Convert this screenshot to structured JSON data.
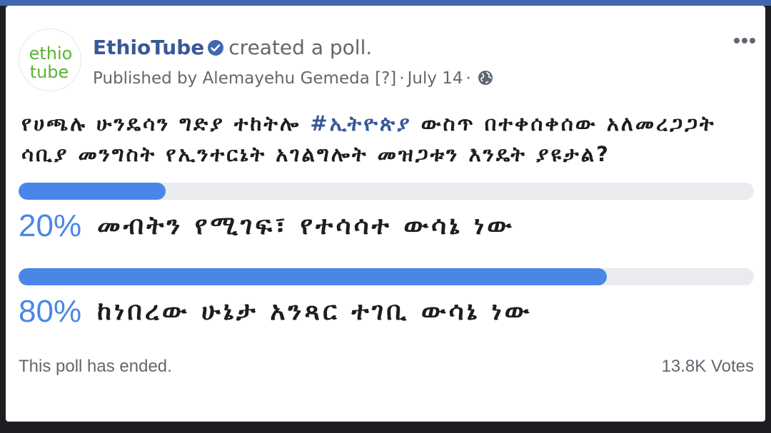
{
  "post": {
    "page_name": "EthioTube",
    "action": "created a poll.",
    "published_by": "Published by Alemayehu Gemeda",
    "help_marker": "[?]",
    "date": "July 14",
    "logo_line1": "ethio",
    "logo_line2": "tube"
  },
  "poll": {
    "question_part1": "የሀጫሉ ሁንዴሳን ግድያ ተከትሎ ",
    "hashtag": "#ኢትዮጵያ",
    "question_part2": " ውስጥ በተቀሰቀሰው አለመረጋጋት ሳቢያ መንግስት የኢንተርኔት አገልግሎት መዝጋቱን እንዴት ያዩታል?",
    "options": [
      {
        "percent_label": "20%",
        "fraction": 0.2,
        "text": "መብትን የሚገፍ፣ የተሳሳተ ውሳኔ ነው"
      },
      {
        "percent_label": "80%",
        "fraction": 0.8,
        "text": "ከነበረው ሁኔታ አንጻር ተገቢ ውሳኔ ነው"
      }
    ],
    "status": "This poll has ended.",
    "votes": "13.8K Votes"
  },
  "colors": {
    "accent": "#4a86e8",
    "link": "#385898",
    "header_bar": "#4267b2",
    "logo_green": "#5ab433"
  },
  "icons": {
    "verified": "verified-badge-icon",
    "globe": "globe-icon",
    "more": "more-options-icon"
  }
}
